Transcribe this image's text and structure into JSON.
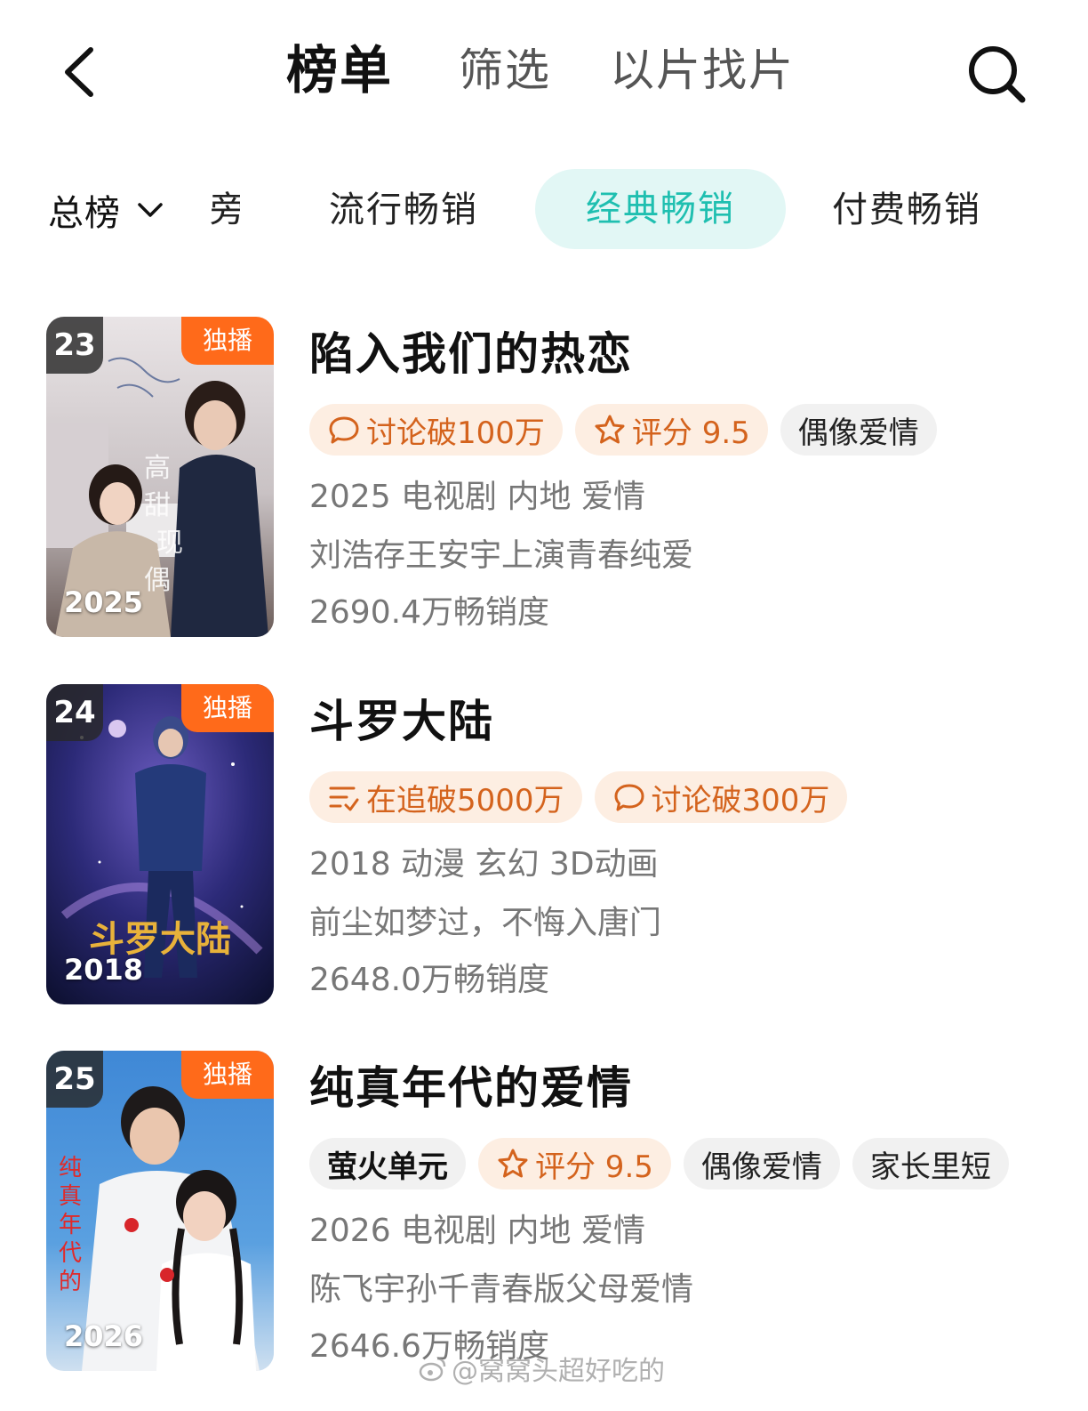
{
  "header": {
    "tabs": [
      {
        "label": "榜单",
        "active": true
      },
      {
        "label": "筛选",
        "active": false
      },
      {
        "label": "以片找片",
        "active": false
      }
    ],
    "icons": {
      "back": "back-arrow-icon",
      "search": "search-icon"
    }
  },
  "categories": {
    "dropdown_label": "总榜",
    "partial_tab": "旁",
    "tabs": [
      {
        "label": "流行畅销",
        "active": false
      },
      {
        "label": "经典畅销",
        "active": true
      },
      {
        "label": "付费畅销",
        "active": false
      }
    ]
  },
  "colors": {
    "accent_teal": "#1fbfb0",
    "accent_pill_bg": "#e2f7f5",
    "exclusive_orange": "#ff6a1a",
    "hot_tag_bg": "#fdeee2",
    "hot_tag_text": "#d4631d"
  },
  "items": [
    {
      "rank": "23",
      "badge": "独播",
      "year_overlay": "2025",
      "title": "陷入我们的热恋",
      "tags": [
        {
          "icon": "comment-icon",
          "text": "讨论破100万",
          "style": "hot"
        },
        {
          "icon": "star-icon",
          "text": "评分 9.5",
          "style": "hot"
        },
        {
          "icon": "",
          "text": "偶像爱情",
          "style": "plain"
        }
      ],
      "meta": "2025 电视剧 内地 爱情",
      "desc": "刘浩存王安宇上演青春纯爱",
      "sales": "2690.4万畅销度"
    },
    {
      "rank": "24",
      "badge": "独播",
      "year_overlay": "2018",
      "title": "斗罗大陆",
      "tags": [
        {
          "icon": "follow-list-icon",
          "text": "在追破5000万",
          "style": "hot"
        },
        {
          "icon": "comment-icon",
          "text": "讨论破300万",
          "style": "hot"
        }
      ],
      "meta": "2018 动漫 玄幻 3D动画",
      "desc": "前尘如梦过，不悔入唐门",
      "sales": "2648.0万畅销度"
    },
    {
      "rank": "25",
      "badge": "独播",
      "year_overlay": "2026",
      "title": "纯真年代的爱情",
      "tags": [
        {
          "icon": "",
          "text": "萤火单元",
          "style": "brand"
        },
        {
          "icon": "star-icon",
          "text": "评分 9.5",
          "style": "hot"
        },
        {
          "icon": "",
          "text": "偶像爱情",
          "style": "plain"
        },
        {
          "icon": "",
          "text": "家长里短",
          "style": "plain"
        }
      ],
      "meta": "2026 电视剧 内地 爱情",
      "desc": "陈飞宇孙千青春版父母爱情",
      "sales": "2646.6万畅销度"
    }
  ],
  "watermark": "@窝窝头超好吃的"
}
